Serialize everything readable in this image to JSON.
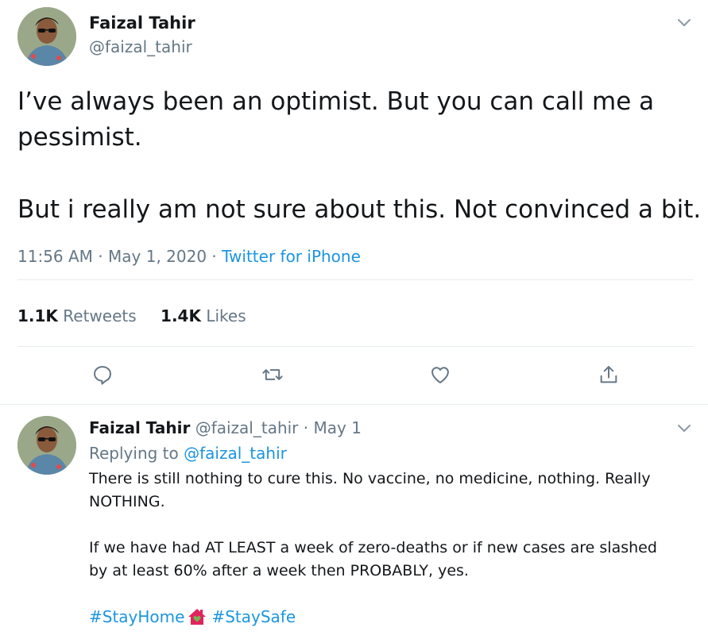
{
  "main_tweet": {
    "author_name": "Faizal Tahir",
    "handle": "@faizal_tahir",
    "text_line1": "I’ve always been an optimist. But you can call me a",
    "text_line2": "pessimist.",
    "text_line3": "But i really am not sure about this. Not convinced a bit.",
    "time": "11:56 AM",
    "separator": "·",
    "date": "May 1, 2020",
    "source": "Twitter for iPhone",
    "retweets_count": "1.1K",
    "retweets_label": "Retweets",
    "likes_count": "1.4K",
    "likes_label": "Likes",
    "actions": [
      "reply-icon",
      "retweet-icon",
      "like-icon",
      "share-icon"
    ]
  },
  "reply_tweet": {
    "author_name": "Faizal Tahir",
    "handle": "@faizal_tahir",
    "separator": "·",
    "date": "May 1",
    "replying_prefix": "Replying to",
    "replying_handle": "@faizal_tahir",
    "para1_line1": "There is still nothing to cure this. No vaccine, no medicine, nothing. Really",
    "para1_line2": "NOTHING.",
    "para2_line1": "If we have had AT LEAST a week of zero-deaths or if new cases are slashed",
    "para2_line2": "by at least 60% after a week then PROBABLY, yes.",
    "hashtag1": "#StayHome",
    "hashtag2": "#StaySafe"
  },
  "colors": {
    "link": "#1b95e0",
    "muted": "#657786",
    "text": "#14171a",
    "divider": "#e6ecf0",
    "house_emoji": "#e0245e"
  }
}
